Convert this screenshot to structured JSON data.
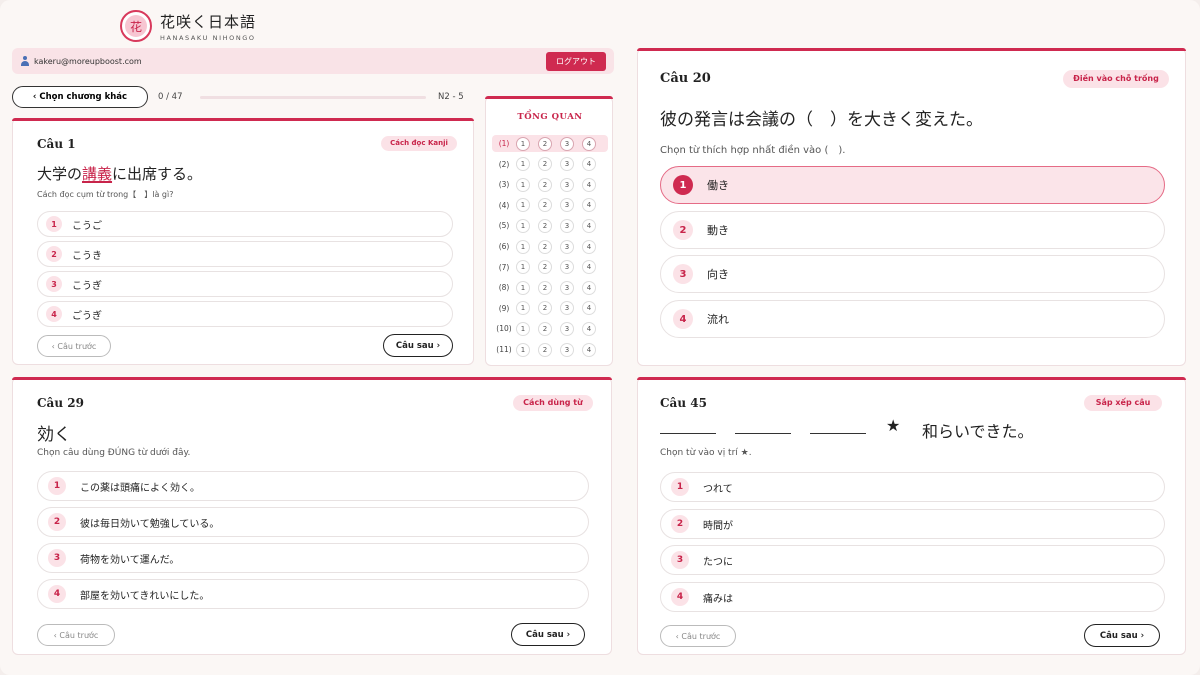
{
  "brand": {
    "jp": "花咲く日本語",
    "en": "HANASAKU NIHONGO",
    "mark": "花"
  },
  "user": {
    "email": "kakeru@moreupboost.com",
    "logout_label": "ログアウト"
  },
  "nav": {
    "chapter_button": "‹ Chọn chương khác",
    "progress_text": "0 / 47",
    "progress_value": 0,
    "level": "N2 - 5"
  },
  "overview": {
    "title": "TỔNG QUAN",
    "rows": [
      {
        "label": "(1)",
        "choices": [
          "1",
          "2",
          "3",
          "4"
        ]
      },
      {
        "label": "(2)",
        "choices": [
          "1",
          "2",
          "3",
          "4"
        ]
      },
      {
        "label": "(3)",
        "choices": [
          "1",
          "2",
          "3",
          "4"
        ]
      },
      {
        "label": "(4)",
        "choices": [
          "1",
          "2",
          "3",
          "4"
        ]
      },
      {
        "label": "(5)",
        "choices": [
          "1",
          "2",
          "3",
          "4"
        ]
      },
      {
        "label": "(6)",
        "choices": [
          "1",
          "2",
          "3",
          "4"
        ]
      },
      {
        "label": "(7)",
        "choices": [
          "1",
          "2",
          "3",
          "4"
        ]
      },
      {
        "label": "(8)",
        "choices": [
          "1",
          "2",
          "3",
          "4"
        ]
      },
      {
        "label": "(9)",
        "choices": [
          "1",
          "2",
          "3",
          "4"
        ]
      },
      {
        "label": "(10)",
        "choices": [
          "1",
          "2",
          "3",
          "4"
        ]
      },
      {
        "label": "(11)",
        "choices": [
          "1",
          "2",
          "3",
          "4"
        ]
      }
    ]
  },
  "q1": {
    "number": "Câu 1",
    "tag": "Cách đọc Kanji",
    "text_before": "大学の",
    "text_mark": "講義",
    "text_after": "に出席する。",
    "hint": "Cách đọc cụm từ trong【　】là gì?",
    "options": [
      {
        "num": "1",
        "text": "こうご"
      },
      {
        "num": "2",
        "text": "こうき"
      },
      {
        "num": "3",
        "text": "こうぎ"
      },
      {
        "num": "4",
        "text": "ごうぎ"
      }
    ],
    "prev_label": "‹ Câu trước",
    "next_label": "Câu sau ›"
  },
  "q20": {
    "number": "Câu 20",
    "tag": "Điền vào chỗ trống",
    "text": "彼の発言は会議の（　）を大きく変えた。",
    "hint": "Chọn từ thích hợp nhất điền vào (　).",
    "options": [
      {
        "num": "1",
        "text": "働き"
      },
      {
        "num": "2",
        "text": "動き"
      },
      {
        "num": "3",
        "text": "向き"
      },
      {
        "num": "4",
        "text": "流れ"
      }
    ],
    "selected": "1"
  },
  "q29": {
    "number": "Câu 29",
    "tag": "Cách dùng từ",
    "text": "効く",
    "hint": "Chọn câu dùng ĐÚNG từ dưới đây.",
    "options": [
      {
        "num": "1",
        "text": "この薬は頭痛によく効く。"
      },
      {
        "num": "2",
        "text": "彼は毎日効いて勉強している。"
      },
      {
        "num": "3",
        "text": "荷物を効いて運んだ。"
      },
      {
        "num": "4",
        "text": "部屋を効いてきれいにした。"
      }
    ],
    "prev_label": "‹ Câu trước",
    "next_label": "Câu sau ›"
  },
  "q45": {
    "number": "Câu 45",
    "tag": "Sắp xếp câu",
    "star": "★",
    "text": "和らいできた。",
    "hint": "Chọn từ vào vị trí ★.",
    "options": [
      {
        "num": "1",
        "text": "つれて"
      },
      {
        "num": "2",
        "text": "時間が"
      },
      {
        "num": "3",
        "text": "たつに"
      },
      {
        "num": "4",
        "text": "痛みは"
      }
    ],
    "prev_label": "‹ Câu trước",
    "next_label": "Câu sau ›"
  },
  "colors": {
    "accent": "#cf2a50",
    "tag_bg": "#fbe2e7",
    "background": "#fbf7f5"
  }
}
